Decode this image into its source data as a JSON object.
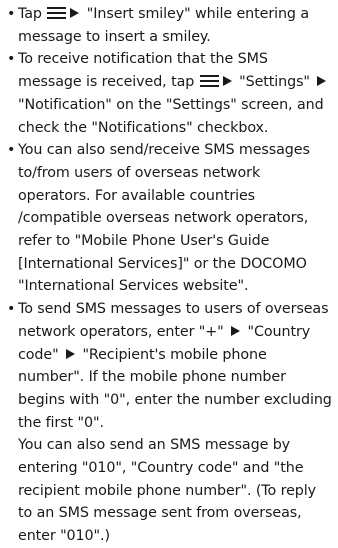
{
  "notes": {
    "bullet_glyph": "•",
    "item1": {
      "p1": "Tap ",
      "p2": " \"Insert smiley\" while entering a message to insert a smiley."
    },
    "item2": {
      "p1": "To receive notification that the SMS message is received, tap ",
      "p2": " \"Settings\" ",
      "p3": " \"Notification\" on the \"Settings\" screen, and check the \"Notifications\" checkbox."
    },
    "item3": {
      "text": "You can also send/receive SMS messages to/from users of overseas network operators. For available countries /compatible overseas network operators, refer to \"Mobile Phone User's Guide [International Services]\" or the DOCOMO \"International Services website\"."
    },
    "item4": {
      "p1": "To send SMS messages to users of overseas network operators, enter \"+\" ",
      "p2": " \"Country code\" ",
      "p3": " \"Recipient's mobile phone number\". If the mobile phone number begins with \"0\", enter the number excluding the first \"0\".",
      "p4": "You can also send an SMS message by entering \"010\", \"Country code\" and \"the recipient mobile phone number\". (To reply to an SMS message sent from overseas, enter \"010\".)"
    }
  },
  "icons": {
    "menu": "menu-icon",
    "arrow": "right-triangle-arrow-icon"
  }
}
